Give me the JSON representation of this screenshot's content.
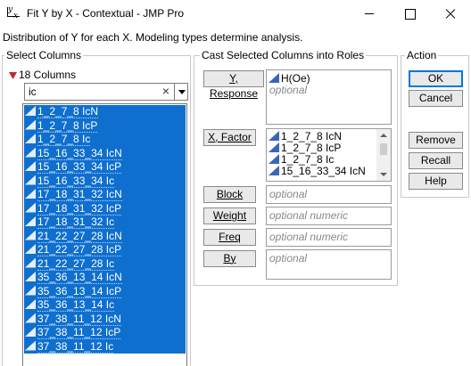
{
  "window": {
    "title": "Fit Y by X - Contextual - JMP Pro",
    "icon": "fit-y-by-x-icon"
  },
  "description": "Distribution of Y for each X. Modeling types determine analysis.",
  "select_columns": {
    "heading": "Select Columns",
    "count_label": "18 Columns",
    "search_value": "ic",
    "search_clear": "×",
    "columns": [
      "1_2_7_8 IcN",
      "1_2_7_8 IcP",
      "1_2_7_8 Ic",
      "15_16_33_34 IcN",
      "15_16_33_34 IcP",
      "15_16_33_34 Ic",
      "17_18_31_32 IcN",
      "17_18_31_32 IcP",
      "17_18_31_32 Ic",
      "21_22_27_28 IcN",
      "21_22_27_28 IcP",
      "21_22_27_28 Ic",
      "35_36_13_14 IcN",
      "35_36_13_14 IcP",
      "35_36_13_14 Ic",
      "37_38_11_12 IcN",
      "37_38_11_12 IcP",
      "37_38_11_12 Ic"
    ]
  },
  "cast": {
    "heading": "Cast Selected Columns into Roles",
    "roles": {
      "y": {
        "button": "Y, Response",
        "items": [
          "H(Oe)"
        ],
        "placeholder": "optional"
      },
      "x": {
        "button": "X, Factor",
        "items": [
          "1_2_7_8 IcN",
          "1_2_7_8 IcP",
          "1_2_7_8 Ic",
          "15_16_33_34 IcN"
        ]
      },
      "block": {
        "button": "Block",
        "placeholder": "optional"
      },
      "weight": {
        "button": "Weight",
        "placeholder": "optional numeric"
      },
      "freq": {
        "button": "Freq",
        "placeholder": "optional numeric"
      },
      "by": {
        "button": "By",
        "placeholder": "optional"
      }
    }
  },
  "action": {
    "heading": "Action",
    "ok": "OK",
    "cancel": "Cancel",
    "remove": "Remove",
    "recall": "Recall",
    "help": "Help"
  },
  "colors": {
    "selection": "#0f6fcf",
    "continuous_icon": "#3a66b5",
    "disclosure_triangle": "#c0272d"
  }
}
